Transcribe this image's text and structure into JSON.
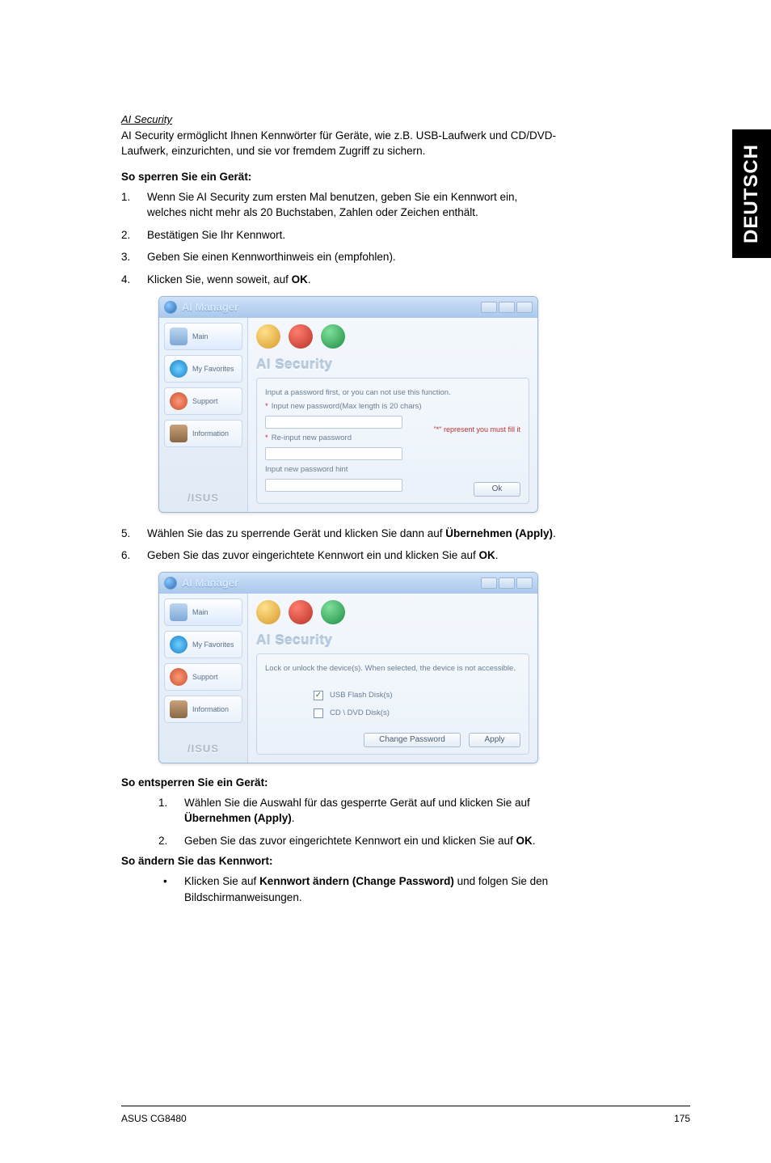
{
  "sidebar_tab": "DEUTSCH",
  "doc": {
    "section_title": "AI Security",
    "intro": "AI Security ermöglicht Ihnen Kennwörter für Geräte, wie z.B. USB-Laufwerk und CD/DVD-Laufwerk, einzurichten, und sie vor fremdem Zugriff zu sichern.",
    "lock_heading": "So sperren Sie ein Gerät:",
    "steps_a": [
      {
        "n": "1.",
        "t": "Wenn Sie AI Security zum ersten Mal benutzen, geben Sie ein Kennwort ein, welches nicht mehr als 20 Buchstaben, Zahlen oder Zeichen enthält."
      },
      {
        "n": "2.",
        "t": "Bestätigen Sie Ihr Kennwort."
      },
      {
        "n": "3.",
        "t": "Geben Sie einen Kennworthinweis ein (empfohlen)."
      },
      {
        "n": "4.",
        "t_pre": "Klicken Sie, wenn soweit, auf ",
        "t_bold": "OK",
        "t_post": "."
      }
    ],
    "steps_b": [
      {
        "n": "5.",
        "t_pre": "Wählen Sie das zu sperrende Gerät und klicken Sie dann auf ",
        "t_bold": "Übernehmen (Apply)",
        "t_post": "."
      },
      {
        "n": "6.",
        "t_pre": "Geben Sie das zuvor eingerichtete Kennwort ein und klicken Sie auf ",
        "t_bold": "OK",
        "t_post": "."
      }
    ],
    "unlock_heading": "So entsperren Sie ein Gerät:",
    "unlock_steps": [
      {
        "n": "1.",
        "t_pre": "Wählen Sie die Auswahl für das gesperrte Gerät auf und klicken Sie auf ",
        "t_bold": "Übernehmen (Apply)",
        "t_post": "."
      },
      {
        "n": "2.",
        "t_pre": "Geben Sie das zuvor eingerichtete Kennwort ein und klicken Sie auf ",
        "t_bold": "OK",
        "t_post": "."
      }
    ],
    "change_heading": "So ändern Sie das Kennwort:",
    "change_bullets": [
      {
        "t_pre": "Klicken Sie auf ",
        "t_bold": "Kennwort ändern (Change Password)",
        "t_post": " und folgen Sie den Bildschirmanweisungen."
      }
    ]
  },
  "shot1": {
    "title": "AI Manager",
    "nav": {
      "main": "Main",
      "fav": "My Favorites",
      "support": "Support",
      "info": "Information"
    },
    "brand": "/ISUS",
    "panel_title": "AI Security",
    "instr": "Input a password first, or you can not use this function.",
    "f1_label": "Input new password(Max length is 20 chars)",
    "f2_label": "Re-input new password",
    "f3_label": "Input new password hint",
    "req": "\"*\" represent you must fill it",
    "ok": "Ok"
  },
  "shot2": {
    "title": "AI Manager",
    "nav": {
      "main": "Main",
      "fav": "My Favorites",
      "support": "Support",
      "info": "Information"
    },
    "brand": "/ISUS",
    "panel_title": "AI Security",
    "instr": "Lock or unlock the device(s). When selected, the device is not accessible.",
    "chk1": "USB Flash Disk(s)",
    "chk2": "CD \\ DVD Disk(s)",
    "btn_change": "Change Password",
    "btn_apply": "Apply"
  },
  "footer": {
    "left": "ASUS CG8480",
    "right": "175"
  }
}
